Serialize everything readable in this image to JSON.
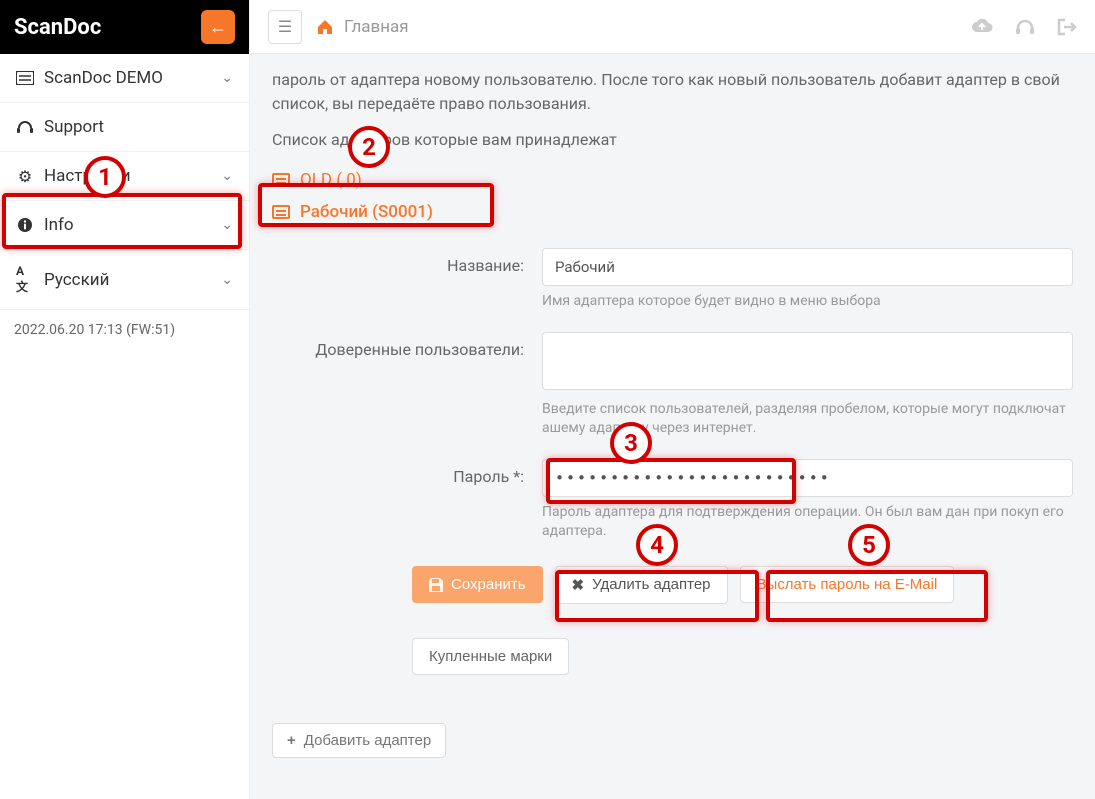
{
  "brand": "ScanDoc",
  "sidebar": {
    "items": [
      {
        "icon": "adapter-icon",
        "label": "ScanDoc DEMO",
        "expandable": true
      },
      {
        "icon": "headset-icon",
        "label": "Support",
        "expandable": false
      },
      {
        "icon": "gear-icon",
        "label": "Настройки",
        "expandable": true
      },
      {
        "icon": "info-icon",
        "label": "Info",
        "expandable": true
      },
      {
        "icon": "language-icon",
        "label": "Русский",
        "expandable": true
      }
    ],
    "version": "2022.06.20 17:13 (FW:51)"
  },
  "topbar": {
    "breadcrumb_home": "Главная"
  },
  "content": {
    "paragraph": "пароль от адаптера новому пользователю. После того как новый пользователь добавит адаптер в свой список, вы передаёте право пользования.",
    "list_title": "Список адаптеров которые вам принадлежат",
    "adapters": [
      {
        "label": "OLD (           0)"
      },
      {
        "label": "Рабочий (S0001)"
      }
    ],
    "form": {
      "name_label": "Название:",
      "name_value": "Рабочий",
      "name_help": "Имя адаптера которое будет видно в меню выбора",
      "trusted_label": "Доверенные пользователи:",
      "trusted_help": "Введите список пользователей, разделяя пробелом, которые могут подключат        ашему адаптеру через интернет.",
      "password_label": "Пароль *:",
      "password_value": "•••••••••••••••••••••••••",
      "password_help": "Пароль адаптера для подтверждения операции. Он был вам дан при покуп       его адаптера."
    },
    "buttons": {
      "save": "Сохранить",
      "delete": "Удалить адаптер",
      "send_pwd": "Выслать пароль на E-Mail",
      "brands": "Купленные марки",
      "add_adapter": "Добавить адаптер"
    }
  },
  "callouts": {
    "1": "1",
    "2": "2",
    "3": "3",
    "4": "4",
    "5": "5"
  }
}
